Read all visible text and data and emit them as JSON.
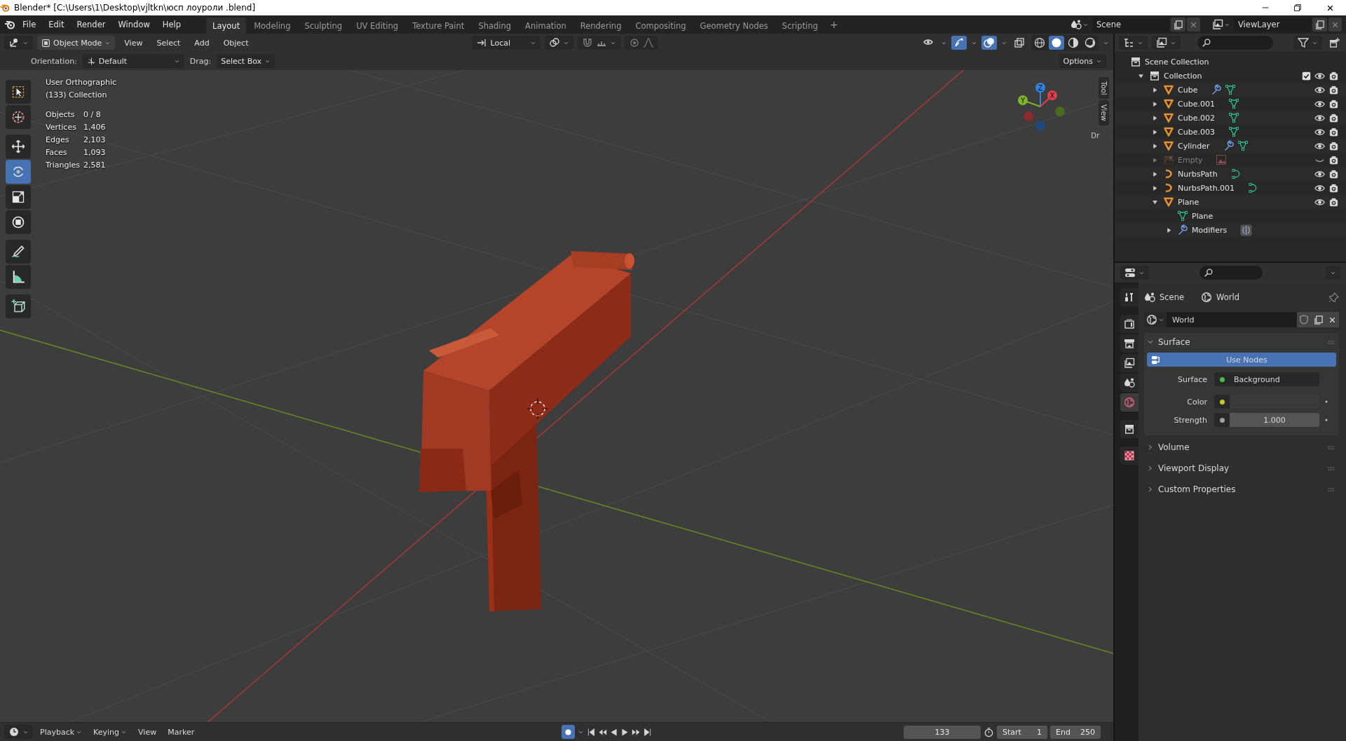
{
  "window": {
    "title": "Blender* [C:\\Users\\1\\Desktop\\vjltkn\\юсп лоуроли .blend]"
  },
  "menu": [
    "File",
    "Edit",
    "Render",
    "Window",
    "Help"
  ],
  "workspaces": [
    {
      "label": "Layout",
      "selected": true
    },
    {
      "label": "Modeling",
      "selected": false
    },
    {
      "label": "Sculpting",
      "selected": false
    },
    {
      "label": "UV Editing",
      "selected": false
    },
    {
      "label": "Texture Paint",
      "selected": false
    },
    {
      "label": "Shading",
      "selected": false
    },
    {
      "label": "Animation",
      "selected": false
    },
    {
      "label": "Rendering",
      "selected": false
    },
    {
      "label": "Compositing",
      "selected": false
    },
    {
      "label": "Geometry Nodes",
      "selected": false
    },
    {
      "label": "Scripting",
      "selected": false
    }
  ],
  "add_workspace": "+",
  "scene": "Scene",
  "view_layer": "ViewLayer",
  "viewport_header": {
    "mode": "Object Mode",
    "menus": [
      "View",
      "Select",
      "Add",
      "Object"
    ],
    "pivot": "Local",
    "toggles": [
      {
        "kind": "visibility",
        "on": false
      },
      {
        "kind": "gizmos",
        "on": true
      },
      {
        "kind": "overlays",
        "on": true
      },
      {
        "kind": "xray",
        "on": false
      }
    ],
    "shading": [
      {
        "kind": "wireframe",
        "selected": false
      },
      {
        "kind": "solid",
        "selected": true
      },
      {
        "kind": "material",
        "selected": false
      },
      {
        "kind": "rendered",
        "selected": false
      }
    ]
  },
  "tool_settings": {
    "orientation_label": "Orientation:",
    "orientation": "Default",
    "drag_label": "Drag:",
    "drag": "Select Box",
    "options": "Options"
  },
  "toolbar": [
    {
      "kind": "select",
      "selected": false
    },
    {
      "kind": "cursor",
      "selected": false
    },
    {
      "kind": "move",
      "selected": false
    },
    {
      "kind": "rotate",
      "selected": true
    },
    {
      "kind": "scale",
      "selected": false
    },
    {
      "kind": "transform",
      "selected": false
    },
    {
      "kind": "annotate",
      "selected": false
    },
    {
      "kind": "measure",
      "selected": false
    },
    {
      "kind": "add_cube",
      "selected": false
    }
  ],
  "overlay": {
    "view_name": "User Orthographic",
    "collection": "(133) Collection",
    "stats": [
      {
        "label": "Objects",
        "value": "0 / 8"
      },
      {
        "label": "Vertices",
        "value": "1,406"
      },
      {
        "label": "Edges",
        "value": "2,103"
      },
      {
        "label": "Faces",
        "value": "1,093"
      },
      {
        "label": "Triangles",
        "value": "2,581"
      }
    ]
  },
  "gizmo_axes": [
    "X",
    "Y",
    "Z"
  ],
  "sidebar_tabs": [
    "Tool",
    "View"
  ],
  "sidebar_cut_text": "Dr",
  "outliner": {
    "root": "Scene Collection",
    "items": [
      {
        "name": "Collection",
        "kind": "collection",
        "expanded": true,
        "checked": true,
        "children": [
          {
            "name": "Cube",
            "kind": "mesh",
            "expanded": false,
            "visible": true,
            "has_modifier": true
          },
          {
            "name": "Cube.001",
            "kind": "mesh",
            "expanded": false,
            "visible": true,
            "has_modifier": false
          },
          {
            "name": "Cube.002",
            "kind": "mesh",
            "expanded": false,
            "visible": true,
            "has_modifier": false
          },
          {
            "name": "Cube.003",
            "kind": "mesh",
            "expanded": false,
            "visible": true,
            "has_modifier": false
          },
          {
            "name": "Cylinder",
            "kind": "mesh",
            "expanded": false,
            "visible": true,
            "has_modifier": true
          },
          {
            "name": "Empty",
            "kind": "empty_image",
            "expanded": false,
            "visible": false
          },
          {
            "name": "NurbsPath",
            "kind": "curve",
            "expanded": false,
            "visible": true
          },
          {
            "name": "NurbsPath.001",
            "kind": "curve",
            "expanded": false,
            "visible": true
          },
          {
            "name": "Plane",
            "kind": "mesh",
            "expanded": true,
            "visible": true,
            "children": [
              {
                "name": "Plane",
                "kind": "mesh_data"
              },
              {
                "name": "Modifiers",
                "kind": "modifiers",
                "expanded": false
              }
            ]
          }
        ]
      }
    ]
  },
  "properties": {
    "breadcrumb": [
      "Scene",
      "World"
    ],
    "tabs": [
      {
        "kind": "tool",
        "selected": false
      },
      {
        "kind": "render",
        "selected": false
      },
      {
        "kind": "output",
        "selected": false
      },
      {
        "kind": "view_layer",
        "selected": false
      },
      {
        "kind": "scene",
        "selected": false
      },
      {
        "kind": "world",
        "selected": true
      },
      {
        "kind": "collection",
        "selected": false
      },
      {
        "kind": "texture",
        "selected": false
      }
    ],
    "world_name": "World",
    "panels": [
      {
        "title": "Surface",
        "expanded": true,
        "use_nodes": "Use Nodes",
        "fields": [
          {
            "label": "Surface",
            "kind": "shader",
            "value": "Background",
            "color": "#4cbb4c"
          },
          {
            "label": "Color",
            "kind": "color",
            "color": "#c8c82a"
          },
          {
            "label": "Strength",
            "kind": "number",
            "value": "1.000",
            "color": "#a0a0a0"
          }
        ]
      },
      {
        "title": "Volume",
        "expanded": false
      },
      {
        "title": "Viewport Display",
        "expanded": false
      },
      {
        "title": "Custom Properties",
        "expanded": false
      }
    ]
  },
  "timeline": {
    "menus": [
      {
        "label": "Playback",
        "dropdown": true
      },
      {
        "label": "Keying",
        "dropdown": true
      },
      {
        "label": "View",
        "dropdown": false
      },
      {
        "label": "Marker",
        "dropdown": false
      }
    ],
    "current_frame": "133",
    "start_label": "Start",
    "start": "1",
    "end_label": "End",
    "end": "250"
  }
}
